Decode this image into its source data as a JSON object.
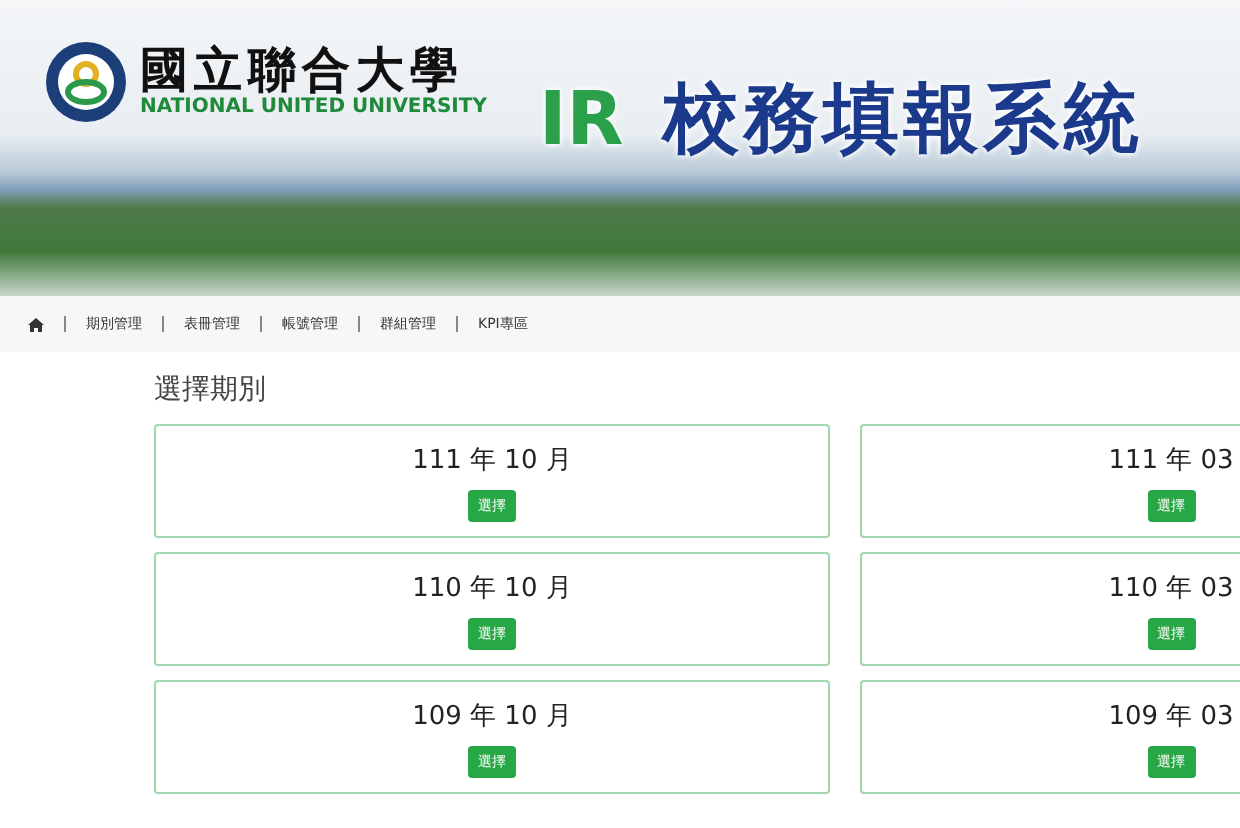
{
  "header": {
    "school_name": "國立聯合大學",
    "school_name_en": "NATIONAL UNITED UNIVERSITY",
    "system_prefix": "IR",
    "system_title": "校務填報系統"
  },
  "nav": {
    "items": [
      {
        "label": "期別管理"
      },
      {
        "label": "表冊管理"
      },
      {
        "label": "帳號管理"
      },
      {
        "label": "群組管理"
      },
      {
        "label": "KPI專區"
      }
    ]
  },
  "heading": "選擇期別",
  "periods": [
    {
      "title": "111 年 10 月",
      "button": "選擇"
    },
    {
      "title": "111 年 03",
      "button": "選擇"
    },
    {
      "title": "110 年 10 月",
      "button": "選擇"
    },
    {
      "title": "110 年 03",
      "button": "選擇"
    },
    {
      "title": "109 年 10 月",
      "button": "選擇"
    },
    {
      "title": "109 年 03",
      "button": "選擇"
    }
  ]
}
